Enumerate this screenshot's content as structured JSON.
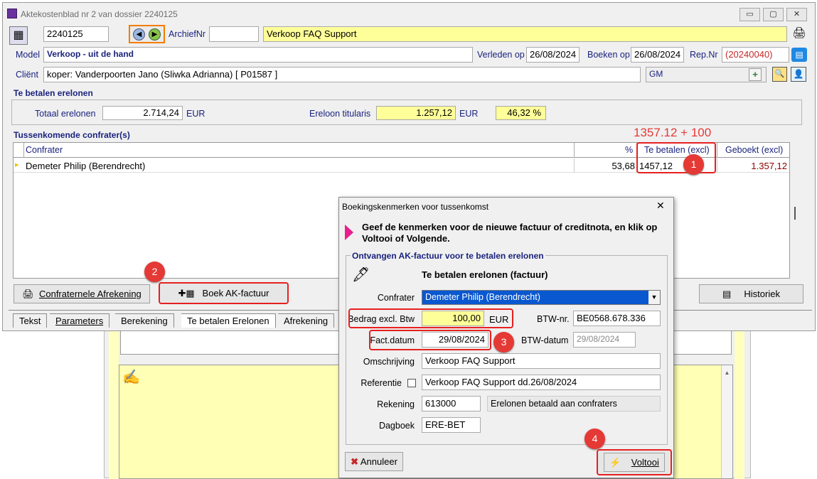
{
  "window": {
    "title": "Aktekostenblad nr 2 van dossier 2240125",
    "min": "▭",
    "max": "▢",
    "close": "✕"
  },
  "header": {
    "dossier_value": "2240125",
    "archief_label": "ArchiefNr",
    "archief_value": "",
    "description_value": "Verkoop FAQ Support",
    "model_label": "Model",
    "model_value": "Verkoop - uit de hand",
    "verleden_label": "Verleden op",
    "verleden_value": "26/08/2024",
    "boeken_label": "Boeken op",
    "boeken_value": "26/08/2024",
    "rep_label": "Rep.Nr",
    "rep_value": "(20240040)",
    "client_label": "Cliënt",
    "client_value": "koper: Vanderpoorten Jano (Sliwka Adrianna) [ P01587 ]",
    "gm_value": "GM"
  },
  "erelonen": {
    "group_label": "Te betalen erelonen",
    "totaal_label": "Totaal erelonen",
    "totaal_value": "2.714,24",
    "totaal_unit": "EUR",
    "titularis_label": "Ereloon titularis",
    "titularis_value": "1.257,12",
    "titularis_unit": "EUR",
    "percent_value": "46,32 %"
  },
  "confraters": {
    "section_label": "Tussenkomende confrater(s)",
    "annotation": "1357.12 + 100",
    "columns": [
      "Confrater",
      "%",
      "Te betalen (excl)",
      "Geboekt (excl)"
    ],
    "rows": [
      {
        "marker": "▸",
        "name": "Demeter Philip (Berendrecht)",
        "pct": "53,68",
        "te_betalen": "1457,12",
        "geboekt": "1.357,12"
      }
    ]
  },
  "buttons": {
    "afrekening": "Confraternele Afrekening",
    "boek": "Boek AK-factuur",
    "historiek": "Historiek"
  },
  "tabs": [
    "Tekst",
    "Parameters",
    "Berekening",
    "Te betalen Erelonen",
    "Afrekening"
  ],
  "badges": [
    "1",
    "2",
    "3",
    "4"
  ],
  "dialog": {
    "title": "Boekingskenmerken voor tussenkomst",
    "close": "✕",
    "instruction": "Geef de kenmerken voor de nieuwe factuur of creditnota, en klik op Voltooi of Volgende.",
    "group_label": "Ontvangen AK-factuur voor te betalen erelonen",
    "heading": "Te betalen erelonen (factuur)",
    "confrater_label": "Confrater",
    "confrater_value": "Demeter Philip (Berendrecht)",
    "bedrag_label": "Bedrag excl. Btw",
    "bedrag_value": "100,00",
    "bedrag_unit": "EUR",
    "btwnr_label": "BTW-nr.",
    "btwnr_value": "BE0568.678.336",
    "factdatum_label": "Fact.datum",
    "factdatum_value": "29/08/2024",
    "btwdatum_label": "BTW-datum",
    "btwdatum_value": "29/08/2024",
    "omschrijving_label": "Omschrijving",
    "omschrijving_value": "Verkoop FAQ Support",
    "referentie_label": "Referentie",
    "referentie_value": "Verkoop FAQ Support dd.26/08/2024",
    "rekening_label": "Rekening",
    "rekening_value": "613000",
    "rekening_desc": "Erelonen betaald aan confraters",
    "dagboek_label": "Dagboek",
    "dagboek_value": "ERE-BET",
    "annuleer": "Annuleer",
    "voltooi": "Voltooi"
  },
  "colors": {
    "accent_red": "#e53935",
    "highlight_yellow": "#ffff99",
    "selection_blue": "#0a58d0",
    "label_blue": "#1a237e"
  }
}
